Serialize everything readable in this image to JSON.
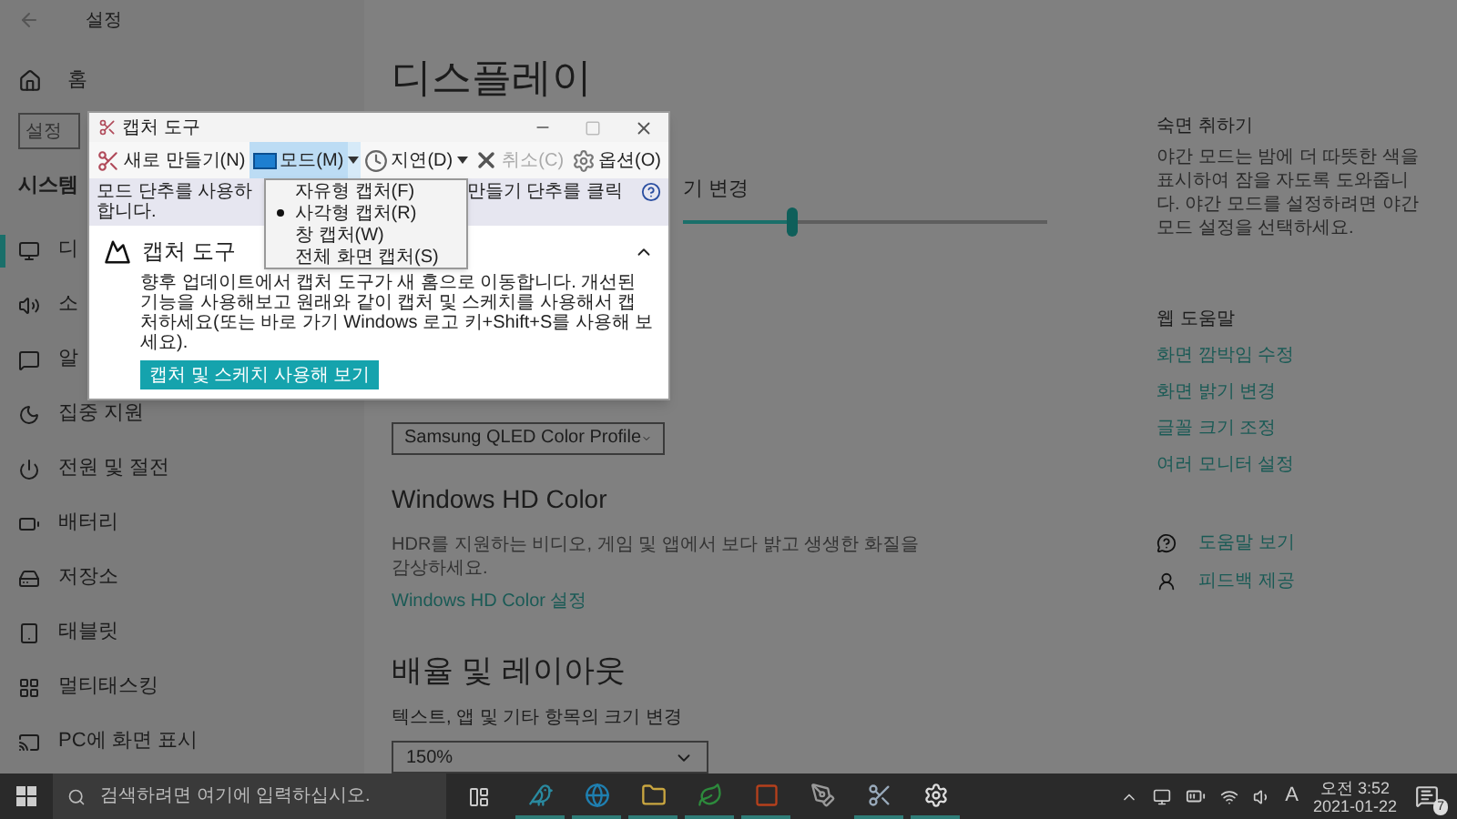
{
  "settings": {
    "title": "설정",
    "home": "홈",
    "search_placeholder": "설정",
    "section": "시스템",
    "nav": [
      {
        "label": "디",
        "selected": true
      },
      {
        "label": "소",
        "selected": false
      },
      {
        "label": "알",
        "selected": false
      },
      {
        "label": "집중 지원",
        "selected": false
      },
      {
        "label": "전원 및 절전",
        "selected": false
      },
      {
        "label": "배터리",
        "selected": false
      },
      {
        "label": "저장소",
        "selected": false
      },
      {
        "label": "태블릿",
        "selected": false
      },
      {
        "label": "멀티태스킹",
        "selected": false
      },
      {
        "label": "PC에 화면 표시",
        "selected": false
      }
    ]
  },
  "main": {
    "title": "디스플레이",
    "partial_label": "기 변경",
    "slider": {
      "level": 0.3
    },
    "profile_dropdown": "Samsung QLED Color Profile",
    "hd_title": "Windows HD Color",
    "hd_desc": "HDR를 지원하는 비디오, 게임 및 앱에서 보다 밝고 생생한 화질을 감상하세요.",
    "hd_link": "Windows HD Color 설정",
    "scale_title": "배율 및 레이아웃",
    "scale_label": "텍스트, 앱 및 기타 항목의 크기 변경",
    "scale_dropdown": "150%"
  },
  "aside": {
    "night_title": "숙면 취하기",
    "night_desc": "야간 모드는 밤에 더 따뜻한 색을 표시하여 잠을 자도록 도와줍니다. 야간 모드를 설정하려면 야간 모드 설정을 선택하세요.",
    "web_help_title": "웹 도움말",
    "links": [
      "화면 깜박임 수정",
      "화면 밝기 변경",
      "글꼴 크기 조정",
      "여러 모니터 설정"
    ],
    "help": [
      "도움말 보기",
      "피드백 제공"
    ]
  },
  "snipping_tool": {
    "title": "캡처 도구",
    "toolbar": [
      {
        "label": "새로 만들기(N)",
        "kind": "new",
        "disabled": false,
        "pressed": false
      },
      {
        "label": "모드(M)",
        "kind": "mode",
        "disabled": false,
        "pressed": true
      },
      {
        "label": "지연(D)",
        "kind": "delay",
        "disabled": false,
        "pressed": false
      },
      {
        "label": "취소(C)",
        "kind": "cancel",
        "disabled": true,
        "pressed": false
      },
      {
        "label": "옵션(O)",
        "kind": "options",
        "disabled": false,
        "pressed": false
      }
    ],
    "info_left": [
      "모드 단추를 사용하",
      "합니다."
    ],
    "info_right": "만들기 단추를 클릭",
    "card_title": "캡처 도구",
    "card_text": "향후 업데이트에서 캡처 도구가 새 홈으로 이동합니다. 개선된 기능을 사용해보고 원래와 같이 캡처 및 스케치를 사용해서 캡처하세요(또는 바로 가기 Windows 로고 키+Shift+S를 사용해 보세요).",
    "card_button": "캡처 및 스케치 사용해 보기",
    "mode_menu": [
      {
        "label": "자유형 캡처(F)",
        "selected": false
      },
      {
        "label": "사각형 캡처(R)",
        "selected": true
      },
      {
        "label": "창 캡처(W)",
        "selected": false
      },
      {
        "label": "전체 화면 캡처(S)",
        "selected": false
      }
    ]
  },
  "taskbar": {
    "search_placeholder": "검색하려면 여기에 입력하십시오.",
    "apps": [
      {
        "running": true
      },
      {
        "running": true
      },
      {
        "running": true
      },
      {
        "running": true
      },
      {
        "running": true
      },
      {
        "running": false
      },
      {
        "running": true
      },
      {
        "running": true
      }
    ],
    "ime": "A",
    "time": "오전 3:52",
    "date": "2021-01-22",
    "notifications": "7"
  }
}
